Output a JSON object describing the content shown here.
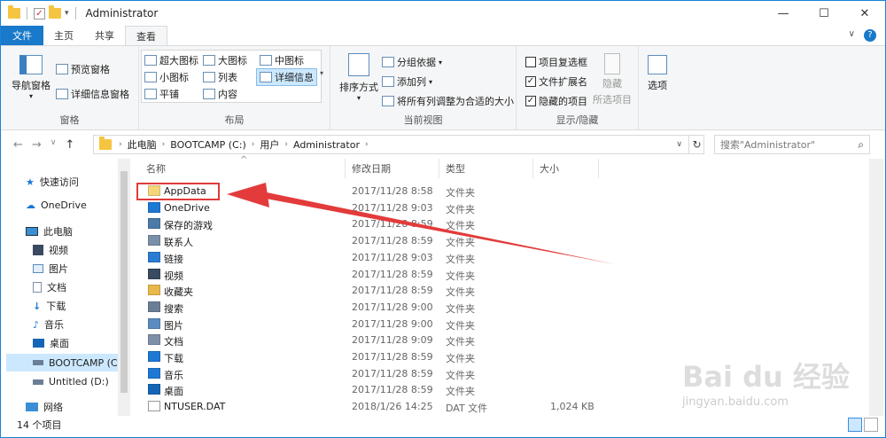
{
  "window": {
    "title": "Administrator",
    "controls": [
      "—",
      "☐",
      "✕"
    ]
  },
  "tabs": [
    {
      "label": "文件",
      "kind": "file"
    },
    {
      "label": "主页",
      "kind": "normal"
    },
    {
      "label": "共享",
      "kind": "normal"
    },
    {
      "label": "查看",
      "kind": "active"
    }
  ],
  "ribbon": {
    "panes": {
      "nav_pane": "导航窗格",
      "preview": "预览窗格",
      "details_pane": "详细信息窗格",
      "label": "窗格"
    },
    "layout": {
      "xlarge": "超大图标",
      "large": "大图标",
      "medium": "中图标",
      "small": "小图标",
      "list": "列表",
      "details": "详细信息",
      "tiles": "平铺",
      "content": "内容",
      "label": "布局"
    },
    "current_view": {
      "sort": "排序方式",
      "group_by": "分组依据",
      "add_column": "添加列",
      "fit_columns": "将所有列调整为合适的大小",
      "label": "当前视图"
    },
    "show_hide": {
      "item_checkboxes": "项目复选框",
      "item_checkboxes_checked": false,
      "file_ext": "文件扩展名",
      "file_ext_checked": true,
      "hidden_items": "隐藏的项目",
      "hidden_items_checked": true,
      "hide": "隐藏",
      "selected_items": "所选项目",
      "label": "显示/隐藏"
    },
    "options": "选项"
  },
  "address": {
    "crumbs": [
      "此电脑",
      "BOOTCAMP (C:)",
      "用户",
      "Administrator"
    ],
    "search_placeholder": "搜索\"Administrator\""
  },
  "sidebar": [
    {
      "label": "快速访问",
      "icon": "star-icon"
    },
    {
      "label": "OneDrive",
      "icon": "cloud-icon"
    },
    {
      "label": "此电脑",
      "icon": "computer-icon"
    },
    {
      "label": "视频",
      "icon": "video-icon"
    },
    {
      "label": "图片",
      "icon": "picture-icon"
    },
    {
      "label": "文档",
      "icon": "document-icon"
    },
    {
      "label": "下载",
      "icon": "download-icon"
    },
    {
      "label": "音乐",
      "icon": "music-icon"
    },
    {
      "label": "桌面",
      "icon": "desktop-icon"
    },
    {
      "label": "BOOTCAMP (C",
      "icon": "drive-icon",
      "selected": true
    },
    {
      "label": "Untitled (D:)",
      "icon": "drive-icon"
    },
    {
      "label": "网络",
      "icon": "network-icon"
    }
  ],
  "columns": {
    "name": "名称",
    "modified": "修改日期",
    "type": "类型",
    "size": "大小"
  },
  "files": [
    {
      "name": "AppData",
      "modified": "2017/11/28 8:58",
      "type": "文件夹",
      "size": "",
      "color": "#f5d77a"
    },
    {
      "name": "OneDrive",
      "modified": "2017/11/28 9:03",
      "type": "文件夹",
      "size": "",
      "color": "#1e78d4"
    },
    {
      "name": "保存的游戏",
      "modified": "2017/11/28 8:59",
      "type": "文件夹",
      "size": "",
      "color": "#4c7aa8"
    },
    {
      "name": "联系人",
      "modified": "2017/11/28 8:59",
      "type": "文件夹",
      "size": "",
      "color": "#7a8fa8"
    },
    {
      "name": "链接",
      "modified": "2017/11/28 9:03",
      "type": "文件夹",
      "size": "",
      "color": "#2b7cd3"
    },
    {
      "name": "视频",
      "modified": "2017/11/28 8:59",
      "type": "文件夹",
      "size": "",
      "color": "#3a4a60"
    },
    {
      "name": "收藏夹",
      "modified": "2017/11/28 8:59",
      "type": "文件夹",
      "size": "",
      "color": "#e8b84a"
    },
    {
      "name": "搜索",
      "modified": "2017/11/28 9:00",
      "type": "文件夹",
      "size": "",
      "color": "#6a7e96"
    },
    {
      "name": "图片",
      "modified": "2017/11/28 9:00",
      "type": "文件夹",
      "size": "",
      "color": "#5b8bbf"
    },
    {
      "name": "文档",
      "modified": "2017/11/28 9:09",
      "type": "文件夹",
      "size": "",
      "color": "#7e90a8"
    },
    {
      "name": "下载",
      "modified": "2017/11/28 8:59",
      "type": "文件夹",
      "size": "",
      "color": "#1e78d4"
    },
    {
      "name": "音乐",
      "modified": "2017/11/28 8:59",
      "type": "文件夹",
      "size": "",
      "color": "#1e78d4"
    },
    {
      "name": "桌面",
      "modified": "2017/11/28 8:59",
      "type": "文件夹",
      "size": "",
      "color": "#1565b6"
    },
    {
      "name": "NTUSER.DAT",
      "modified": "2018/1/26 14:25",
      "type": "DAT 文件",
      "size": "1,024 KB",
      "color": "#ffffff"
    }
  ],
  "status": {
    "count": "14 个项目"
  },
  "watermark": {
    "brand": "Bai du 经验",
    "url": "jingyan.baidu.com"
  },
  "colors": {
    "accent": "#1979ca",
    "highlight": "#e03a3a"
  }
}
